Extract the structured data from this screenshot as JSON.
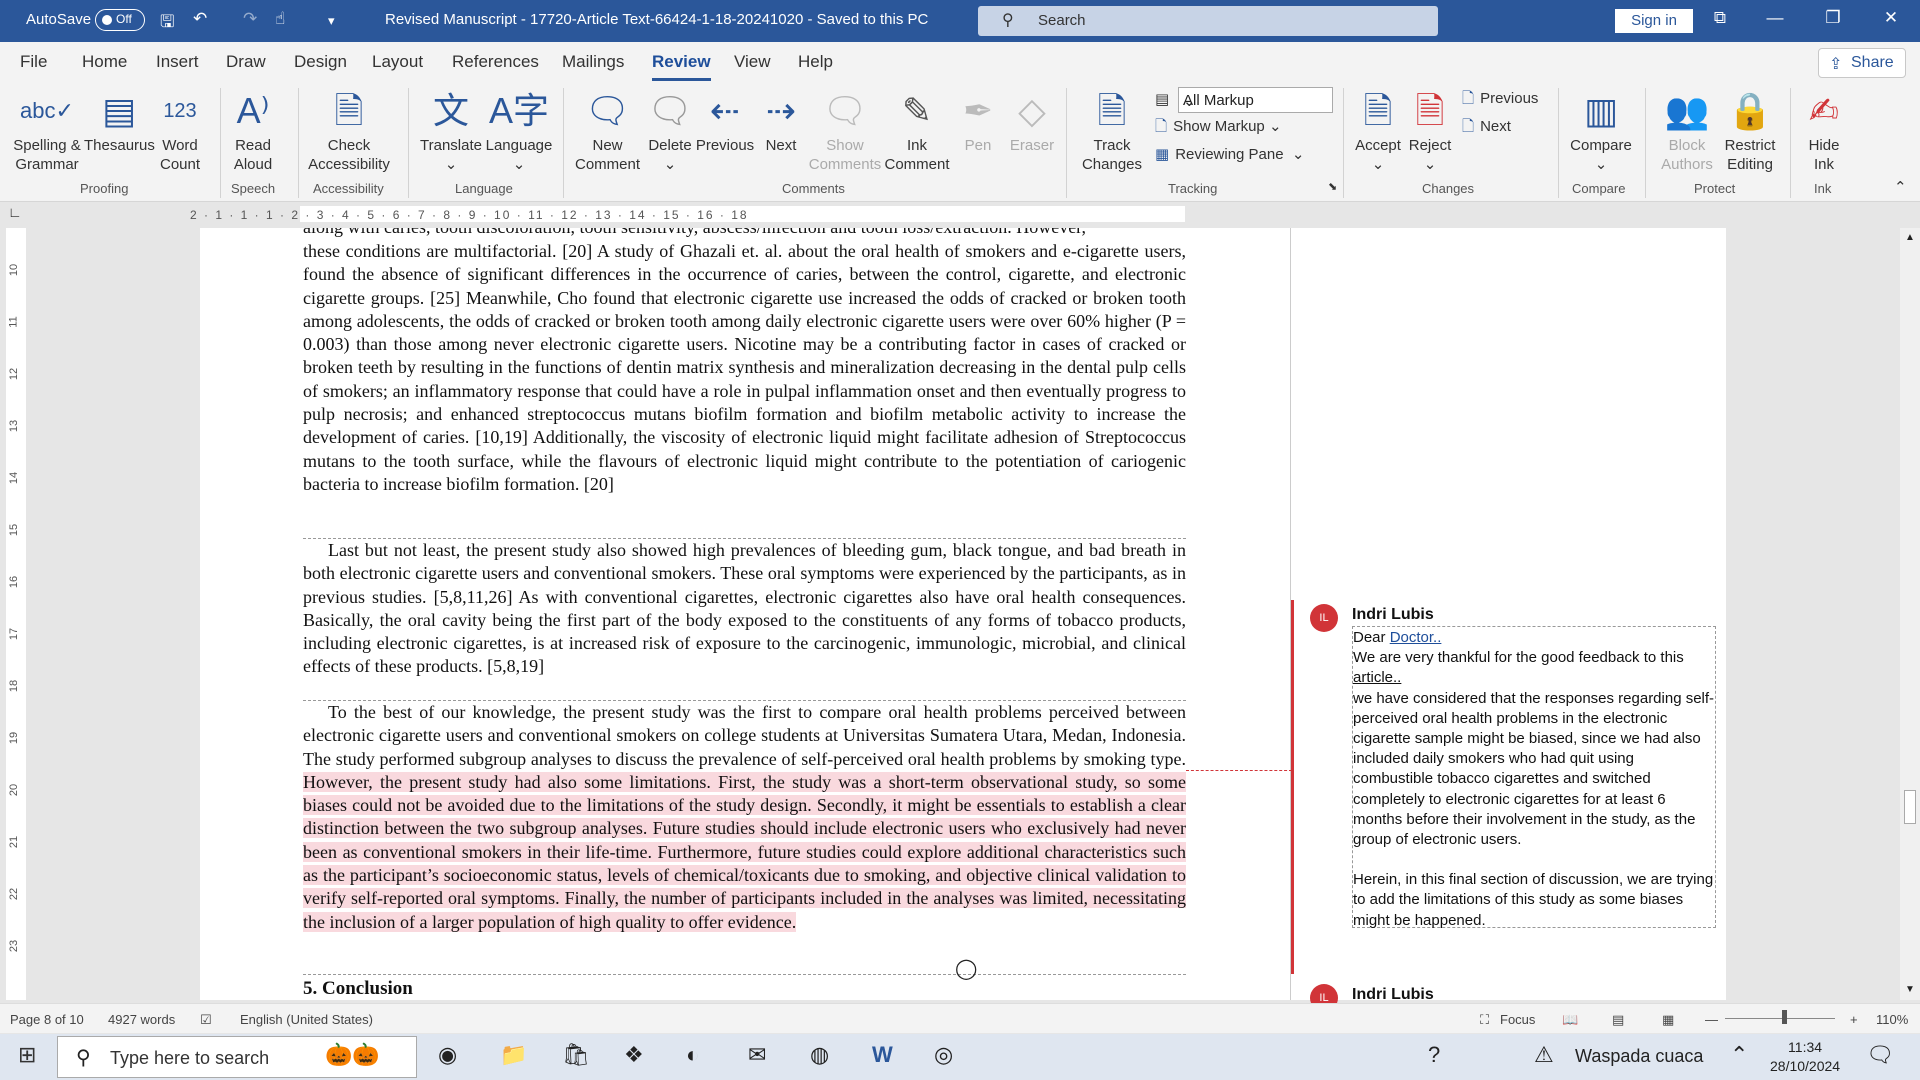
{
  "titlebar": {
    "autosave": "AutoSave",
    "toggle": "Off",
    "doc_title": "Revised Manuscript - 17720-Article Text-66424-1-18-20241020  -  Saved to this PC",
    "search": "Search",
    "signin": "Sign in"
  },
  "menu": {
    "tabs": [
      "File",
      "Home",
      "Insert",
      "Draw",
      "Design",
      "Layout",
      "References",
      "Mailings",
      "Review",
      "View",
      "Help"
    ],
    "share": "Share"
  },
  "ribbon": {
    "spelling": [
      "Spelling &",
      "Grammar"
    ],
    "thesaurus": "Thesaurus",
    "wordcount": [
      "Word",
      "Count"
    ],
    "readaloud": [
      "Read",
      "Aloud"
    ],
    "checkacc": [
      "Check",
      "Accessibility"
    ],
    "translate": "Translate",
    "language": "Language",
    "newcomment": [
      "New",
      "Comment"
    ],
    "delete": "Delete",
    "previous": "Previous",
    "next": "Next",
    "showcomments": [
      "Show",
      "Comments"
    ],
    "inkcomment": [
      "Ink",
      "Comment"
    ],
    "pen": "Pen",
    "eraser": "Eraser",
    "trackchanges": [
      "Track",
      "Changes"
    ],
    "allmarkup": "All Markup",
    "showmarkup": "Show Markup",
    "reviewingpane": "Reviewing Pane",
    "accept": "Accept",
    "reject": "Reject",
    "prevchange": "Previous",
    "nextchange": "Next",
    "compare": "Compare",
    "blockauthors": [
      "Block",
      "Authors"
    ],
    "restrictediting": [
      "Restrict",
      "Editing"
    ],
    "hideink": [
      "Hide",
      "Ink"
    ],
    "groups": {
      "proofing": "Proofing",
      "speech": "Speech",
      "accessibility": "Accessibility",
      "language": "Language",
      "comments": "Comments",
      "tracking": "Tracking",
      "changes": "Changes",
      "compare": "Compare",
      "protect": "Protect",
      "ink": "Ink"
    }
  },
  "ruler": {
    "h": "2 · 1 · 1 · 1 · 2 · 3 · 4 · 5 · 6 · 7 · 8 · 9 · 10 · 11 · 12 · 13 · 14 · 15 · 16 · 18",
    "v": [
      "10",
      "11",
      "12",
      "13",
      "14",
      "15",
      "16",
      "17",
      "18",
      "19",
      "20",
      "21",
      "22",
      "23"
    ]
  },
  "doc": {
    "top_partial": "along with caries, tooth discoloration, tooth sensitivity, abscess/infection and tooth loss/extraction. However,",
    "p1": "these conditions are multifactorial. [20] A study of Ghazali et. al. about the oral health of smokers and e-cigarette users, found the absence of significant differences in the occurrence of caries, between the control, cigarette, and electronic cigarette groups. [25] Meanwhile, Cho found that electronic cigarette use increased the odds of cracked or broken tooth among adolescents, the odds of cracked or broken tooth among daily electronic cigarette users were over 60% higher (P = 0.003) than those among never electronic cigarette users. Nicotine may be a contributing factor in cases of cracked or broken teeth by resulting in the functions of dentin matrix synthesis and mineralization decreasing in the dental pulp cells of smokers; an inflammatory response that could have a role in pulpal inflammation onset and then eventually progress to pulp necrosis; and enhanced streptococcus mutans biofilm formation and biofilm metabolic activity to increase the development of caries. [10,19] Additionally, the viscosity of electronic liquid might facilitate adhesion of Streptococcus mutans to the tooth surface, while the flavours of electronic liquid might contribute to the potentiation of cariogenic bacteria to increase biofilm formation. [20]",
    "p2": "Last but not least, the present study also showed high prevalences of bleeding gum, black tongue, and bad breath in both electronic cigarette users and conventional smokers. These oral symptoms were experienced by the participants, as in previous studies. [5,8,11,26] As with conventional cigarettes, electronic cigarettes also have oral health consequences. Basically, the oral cavity being the first part of the body exposed to the constituents of any forms of tobacco products, including electronic cigarettes, is at increased risk of exposure to the carcinogenic, immunologic, microbial, and clinical effects of these products. [5,8,19]",
    "p3a": "To the best of our knowledge, the present study was the first to compare oral health problems perceived between electronic cigarette users and conventional smokers on college students at Universitas Sumatera Utara, Medan, Indonesia. The study performed subgroup analyses to discuss the prevalence of self-perceived oral health problems by smoking type. ",
    "p3b": "However, the present study had also some limitations. First, the study was a short-term observational study, so some biases could not be avoided due to the limitations of the study design. Secondly, it might be essentials to establish a clear distinction between the two subgroup analyses. Future studies should include electronic users who exclusively had never been as conventional smokers in their life-time. Furthermore, future studies could explore additional characteristics such as the participant’s socioeconomic status, levels of chemical/toxicants due to smoking, and objective clinical validation to verify self-reported oral symptoms. Finally, the number of participants included in the analyses was limited, necessitating the inclusion of a larger population of high quality to offer evidence.",
    "heading": "5. Conclusion"
  },
  "comments": [
    {
      "initials": "IL",
      "author": "Indri Lubis",
      "dear": "Dear ",
      "doctor": "Doctor..",
      "thanks": "We are very thankful for the good feedback to this ",
      "article": "article..",
      "body1": "we have considered that the responses regarding self-perceived oral health problems in the electronic cigarette sample might be biased, since we had also included daily smokers who had quit using combustible tobacco cigarettes and switched completely to electronic cigarettes for at least 6 months before their involvement in the study, as the group of electronic users.",
      "body2": "Herein, in this final section of discussion, we are trying to add the limitations of this study as some biases might be happened."
    },
    {
      "initials": "IL",
      "author": "Indri Lubis"
    }
  ],
  "status": {
    "page": "Page 8 of 10",
    "words": "4927 words",
    "language": "English (United States)",
    "focus": "Focus",
    "zoom": "110%"
  },
  "taskbar": {
    "search": "Type here to search",
    "weather": "Waspada cuaca",
    "time": "11:34",
    "date": "28/10/2024"
  },
  "colors": {
    "accent": "#2b579a",
    "comment": "#d13438",
    "highlight": "#f9d9de"
  }
}
